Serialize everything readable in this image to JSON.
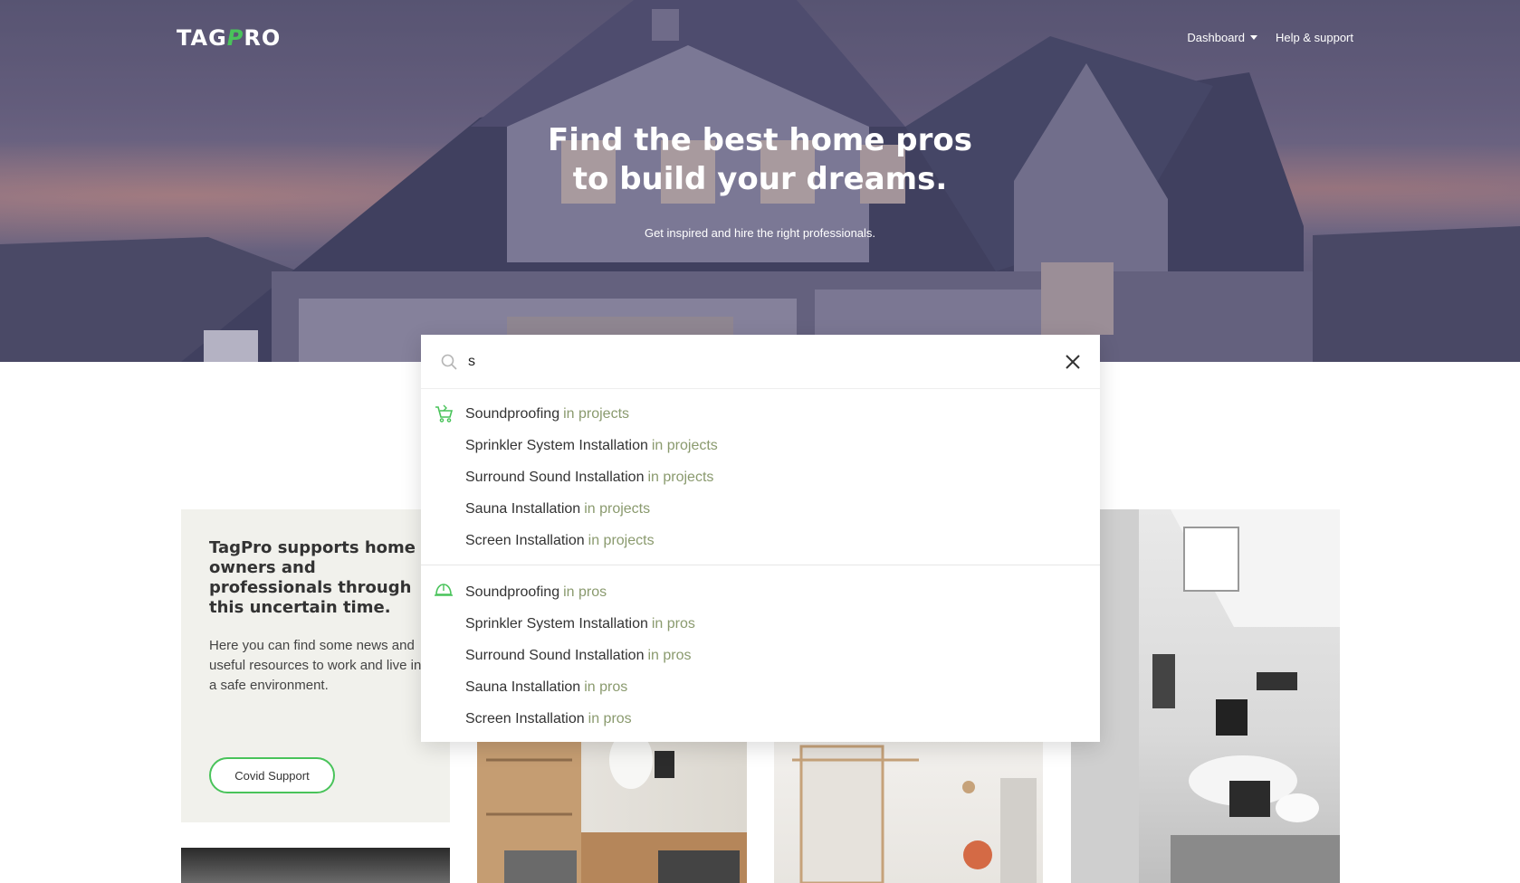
{
  "header": {
    "logo_prefix": "TAG",
    "logo_accent": "P",
    "logo_suffix": "RO",
    "nav": [
      {
        "label": "Dashboard",
        "has_caret": true
      },
      {
        "label": "Help & support",
        "has_caret": false
      }
    ]
  },
  "hero": {
    "title_line1": "Find the best home pros",
    "title_line2": "to build your dreams.",
    "subtitle": "Get inspired and hire the right professionals."
  },
  "search": {
    "query": "s",
    "icon": "search-icon",
    "close_icon": "close-icon",
    "groups": [
      {
        "icon": "project-cart-icon",
        "scope_label": "in projects",
        "items": [
          "Soundproofing",
          "Sprinkler System Installation",
          "Surround Sound Installation",
          "Sauna Installation",
          "Screen Installation"
        ]
      },
      {
        "icon": "hard-hat-icon",
        "scope_label": "in pros",
        "items": [
          "Soundproofing",
          "Sprinkler System Installation",
          "Surround Sound Installation",
          "Sauna Installation",
          "Screen Installation"
        ]
      }
    ],
    "accent_color": "#49c35a",
    "scope_color": "#8a9a6e"
  },
  "covid_card": {
    "heading": "TagPro supports home owners and professionals through this uncertain time.",
    "body": "Here you can find some news and useful resources to work and live in a safe environment.",
    "button_label": "Covid Support"
  }
}
